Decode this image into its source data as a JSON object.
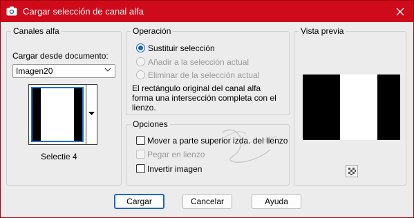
{
  "window": {
    "title": "Cargar selección de canal alfa"
  },
  "canales": {
    "legend": "Canales alfa",
    "load_label": "Cargar desde documento:",
    "document_value": "Imagen20",
    "channel_name": "Selectie 4"
  },
  "operacion": {
    "legend": "Operación",
    "options": [
      {
        "label": "Sustituir selección",
        "selected": true,
        "enabled": true
      },
      {
        "label": "Añadir a la selección actual",
        "selected": false,
        "enabled": false
      },
      {
        "label": "Eliminar de la selección actual",
        "selected": false,
        "enabled": false
      }
    ],
    "description": "El rectángulo original del canal alfa forma una intersección completa con el lienzo."
  },
  "opciones": {
    "legend": "Opciones",
    "items": [
      {
        "label": "Mover a parte superior izda. del lienzo",
        "checked": false,
        "enabled": true
      },
      {
        "label": "Pegar en lienzo",
        "checked": false,
        "enabled": false
      },
      {
        "label": "Invertir imagen",
        "checked": false,
        "enabled": true
      }
    ]
  },
  "vista_previa": {
    "legend": "Vista previa"
  },
  "buttons": {
    "load": "Cargar",
    "cancel": "Cancelar",
    "help": "Ayuda"
  },
  "colors": {
    "title_bar": "#cf0a1a",
    "accent": "#1565c0"
  },
  "icons": {
    "title": "camera-icon",
    "close": "close-icon",
    "dropdown": "chevron-down-icon",
    "preview_toggle": "checkerboard-icon"
  }
}
